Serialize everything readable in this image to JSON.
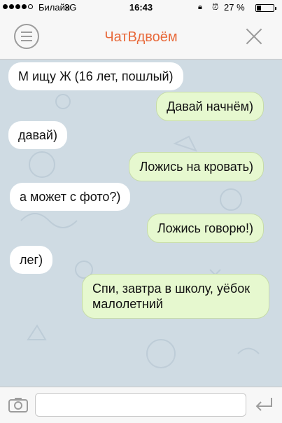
{
  "status_bar": {
    "carrier": "Билайн",
    "network": "3G",
    "time": "16:43",
    "battery_percent": "27 %",
    "battery_level": 0.27,
    "signal_bars_filled": 4,
    "signal_bars_total": 5
  },
  "nav": {
    "title": "ЧатВдвоём",
    "menu_icon": "hamburger-icon",
    "close_icon": "close-icon"
  },
  "messages": [
    {
      "side": "in",
      "text": "М ищу Ж (16 лет, пошлый)"
    },
    {
      "side": "out",
      "text": "Давай начнём)"
    },
    {
      "side": "in",
      "text": "давай)"
    },
    {
      "side": "out",
      "text": "Ложись на кровать)"
    },
    {
      "side": "in",
      "text": "а может с фото?)"
    },
    {
      "side": "out",
      "text": "Ложись говорю!)"
    },
    {
      "side": "in",
      "text": "лег)"
    },
    {
      "side": "out",
      "text": "Спи, завтра в школу, уёбок малолетний"
    }
  ],
  "input": {
    "value": "",
    "camera_icon": "camera-icon",
    "send_icon": "send-arrow-icon"
  },
  "colors": {
    "accent": "#e8693a",
    "chat_background": "#cfdbe3",
    "incoming_bubble": "#ffffff",
    "outgoing_bubble": "#e6f8cf"
  }
}
